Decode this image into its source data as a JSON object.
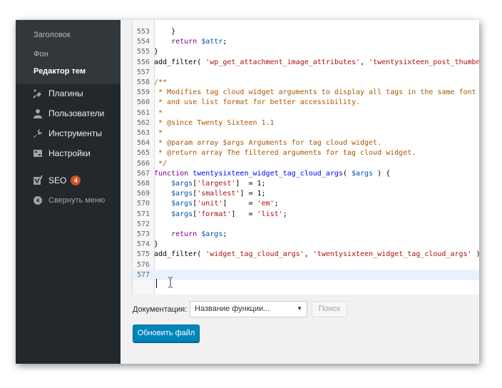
{
  "sidebar": {
    "submenu": [
      {
        "label": "Заголовок"
      },
      {
        "label": "Фон"
      },
      {
        "label": "Редактор тем"
      }
    ],
    "items": [
      {
        "label": "Плагины",
        "icon": "plugin-icon"
      },
      {
        "label": "Пользователи",
        "icon": "user-icon"
      },
      {
        "label": "Инструменты",
        "icon": "wrench-icon"
      },
      {
        "label": "Настройки",
        "icon": "settings-icon"
      },
      {
        "label": "SEO",
        "icon": "seo-icon",
        "badge": "4"
      },
      {
        "label": "Свернуть меню",
        "icon": "collapse-icon"
      }
    ]
  },
  "editor": {
    "lines": [
      {
        "num": "553",
        "tokens": [
          {
            "t": "    }",
            "c": "c-text"
          }
        ]
      },
      {
        "num": "554",
        "tokens": [
          {
            "t": "    ",
            "c": "c-text"
          },
          {
            "t": "return",
            "c": "c-kw"
          },
          {
            "t": " ",
            "c": "c-text"
          },
          {
            "t": "$attr",
            "c": "c-var"
          },
          {
            "t": ";",
            "c": "c-text"
          }
        ]
      },
      {
        "num": "555",
        "tokens": [
          {
            "t": "}",
            "c": "c-text"
          }
        ]
      },
      {
        "num": "556",
        "tokens": [
          {
            "t": "add_filter( ",
            "c": "c-text"
          },
          {
            "t": "'wp_get_attachment_image_attributes'",
            "c": "c-str"
          },
          {
            "t": ", ",
            "c": "c-text"
          },
          {
            "t": "'twentysixteen_post_thumbn",
            "c": "c-str"
          }
        ]
      },
      {
        "num": "557",
        "tokens": []
      },
      {
        "num": "558",
        "tokens": [
          {
            "t": "/**",
            "c": "c-com"
          }
        ]
      },
      {
        "num": "559",
        "tokens": [
          {
            "t": " * Modifies tag cloud widget arguments to display all tags in the same font",
            "c": "c-com"
          }
        ]
      },
      {
        "num": "560",
        "tokens": [
          {
            "t": " * and use list format for better accessibility.",
            "c": "c-com"
          }
        ]
      },
      {
        "num": "561",
        "tokens": [
          {
            "t": " *",
            "c": "c-com"
          }
        ]
      },
      {
        "num": "562",
        "tokens": [
          {
            "t": " * @since Twenty Sixteen 1.1",
            "c": "c-com"
          }
        ]
      },
      {
        "num": "563",
        "tokens": [
          {
            "t": " *",
            "c": "c-com"
          }
        ]
      },
      {
        "num": "564",
        "tokens": [
          {
            "t": " * @param array $args Arguments for tag cloud widget.",
            "c": "c-com"
          }
        ]
      },
      {
        "num": "565",
        "tokens": [
          {
            "t": " * @return array The filtered arguments for tag cloud widget.",
            "c": "c-com"
          }
        ]
      },
      {
        "num": "566",
        "tokens": [
          {
            "t": " */",
            "c": "c-com"
          }
        ]
      },
      {
        "num": "567",
        "tokens": [
          {
            "t": "function",
            "c": "c-kw"
          },
          {
            "t": " ",
            "c": "c-text"
          },
          {
            "t": "twentysixteen_widget_tag_cloud_args",
            "c": "c-def"
          },
          {
            "t": "( ",
            "c": "c-text"
          },
          {
            "t": "$args",
            "c": "c-var"
          },
          {
            "t": " ) {",
            "c": "c-text"
          }
        ]
      },
      {
        "num": "568",
        "tokens": [
          {
            "t": "    ",
            "c": "c-text"
          },
          {
            "t": "$args",
            "c": "c-var"
          },
          {
            "t": "[",
            "c": "c-text"
          },
          {
            "t": "'largest'",
            "c": "c-str"
          },
          {
            "t": "]  = 1;",
            "c": "c-text"
          }
        ]
      },
      {
        "num": "569",
        "tokens": [
          {
            "t": "    ",
            "c": "c-text"
          },
          {
            "t": "$args",
            "c": "c-var"
          },
          {
            "t": "[",
            "c": "c-text"
          },
          {
            "t": "'smallest'",
            "c": "c-str"
          },
          {
            "t": "] = 1;",
            "c": "c-text"
          }
        ]
      },
      {
        "num": "570",
        "tokens": [
          {
            "t": "    ",
            "c": "c-text"
          },
          {
            "t": "$args",
            "c": "c-var"
          },
          {
            "t": "[",
            "c": "c-text"
          },
          {
            "t": "'unit'",
            "c": "c-str"
          },
          {
            "t": "]     = ",
            "c": "c-text"
          },
          {
            "t": "'em'",
            "c": "c-str"
          },
          {
            "t": ";",
            "c": "c-text"
          }
        ]
      },
      {
        "num": "571",
        "tokens": [
          {
            "t": "    ",
            "c": "c-text"
          },
          {
            "t": "$args",
            "c": "c-var"
          },
          {
            "t": "[",
            "c": "c-text"
          },
          {
            "t": "'format'",
            "c": "c-str"
          },
          {
            "t": "]   = ",
            "c": "c-text"
          },
          {
            "t": "'list'",
            "c": "c-str"
          },
          {
            "t": ";",
            "c": "c-text"
          }
        ]
      },
      {
        "num": "572",
        "tokens": []
      },
      {
        "num": "573",
        "tokens": [
          {
            "t": "    ",
            "c": "c-text"
          },
          {
            "t": "return",
            "c": "c-kw"
          },
          {
            "t": " ",
            "c": "c-text"
          },
          {
            "t": "$args",
            "c": "c-var"
          },
          {
            "t": ";",
            "c": "c-text"
          }
        ]
      },
      {
        "num": "574",
        "tokens": [
          {
            "t": "}",
            "c": "c-text"
          }
        ]
      },
      {
        "num": "575",
        "tokens": [
          {
            "t": "add_filter( ",
            "c": "c-text"
          },
          {
            "t": "'widget_tag_cloud_args'",
            "c": "c-str"
          },
          {
            "t": ", ",
            "c": "c-text"
          },
          {
            "t": "'twentysixteen_widget_tag_cloud_args'",
            "c": "c-str"
          },
          {
            "t": " );",
            "c": "c-text"
          }
        ]
      },
      {
        "num": "576",
        "tokens": []
      },
      {
        "num": "577",
        "tokens": [],
        "active": true
      }
    ]
  },
  "documentation": {
    "label": "Документация:",
    "select_value": "Название функции...",
    "search_label": "Поиск"
  },
  "update_button": "Обновить файл",
  "colors": {
    "sidebar_bg": "#23282d",
    "primary_button": "#0085ba",
    "badge": "#d54e21"
  }
}
